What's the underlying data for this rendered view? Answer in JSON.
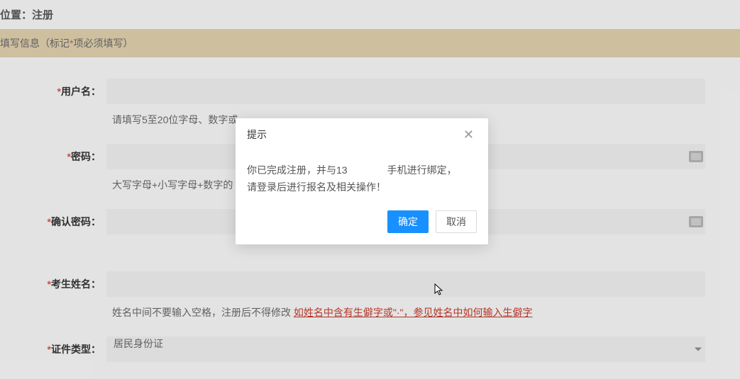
{
  "header": {
    "breadcrumb_prefix": "位置：",
    "breadcrumb_current": "注册"
  },
  "info_bar": {
    "prefix": "填写信息（标记",
    "required_mark": "*",
    "suffix": "项必须填写）"
  },
  "form": {
    "fields": {
      "username": {
        "label": "用户名：",
        "value": "",
        "hint": "请填写5至20位字母、数字或"
      },
      "password": {
        "label": "密码：",
        "value": "",
        "hint": "大写字母+小写字母+数字的"
      },
      "confirm_password": {
        "label": "确认密码：",
        "value": "",
        "hint": ""
      },
      "candidate_name": {
        "label": "考生姓名：",
        "value": "",
        "hint_prefix": "姓名中间不要输入空格，注册后不得修改 ",
        "hint_link": "如姓名中含有生僻字或\"·\"，参见姓名中如何输入生僻字"
      },
      "id_type": {
        "label": "证件类型：",
        "selected": "居民身份证"
      }
    }
  },
  "modal": {
    "title": "提示",
    "body_line1_part1": "你已完成注册，并与13",
    "body_line1_masked": "　　　　",
    "body_line1_part2": "手机进行绑定，",
    "body_line2": "请登录后进行报名及相关操作！",
    "confirm_label": "确定",
    "cancel_label": "取消"
  }
}
